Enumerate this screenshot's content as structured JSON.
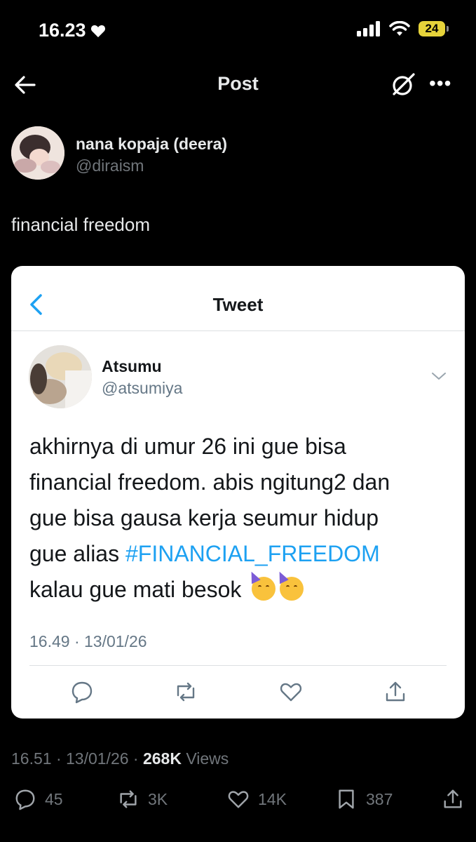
{
  "status_bar": {
    "time": "16.23",
    "battery": "24"
  },
  "nav": {
    "title": "Post"
  },
  "post": {
    "author_name": "nana kopaja (deera)",
    "author_handle": "@diraism",
    "text": "financial freedom",
    "timestamp": "16.51 · 13/01/26 ·",
    "views_count": "268K",
    "views_label": "Views",
    "actions": {
      "replies": "45",
      "retweets": "3K",
      "likes": "14K",
      "bookmarks": "387"
    }
  },
  "embedded_tweet": {
    "header_title": "Tweet",
    "author_name": "Atsumu",
    "author_handle": "@atsumiya",
    "text_lines": [
      "akhirnya di umur 26 ini gue bisa",
      "financial freedom. abis ngitung2 dan",
      "gue bisa gausa kerja seumur hidup",
      "gue alias ",
      "kalau gue mati besok "
    ],
    "hashtag": "#FINANCIAL_FREEDOM",
    "timestamp": "16.49 · 13/01/26",
    "accent_color": "#1da1f2"
  },
  "icons": {
    "status": [
      "heart-icon",
      "signal-icon",
      "wifi-icon",
      "battery-icon"
    ],
    "nav": [
      "back-arrow-icon",
      "grok-icon",
      "more-icon"
    ],
    "embedded_actions": [
      "reply-icon",
      "retweet-icon",
      "like-icon",
      "share-icon"
    ],
    "post_actions": [
      "reply-icon",
      "retweet-icon",
      "like-icon",
      "bookmark-icon",
      "share-icon"
    ],
    "emoji": [
      "partying-face-emoji",
      "partying-face-emoji"
    ]
  }
}
